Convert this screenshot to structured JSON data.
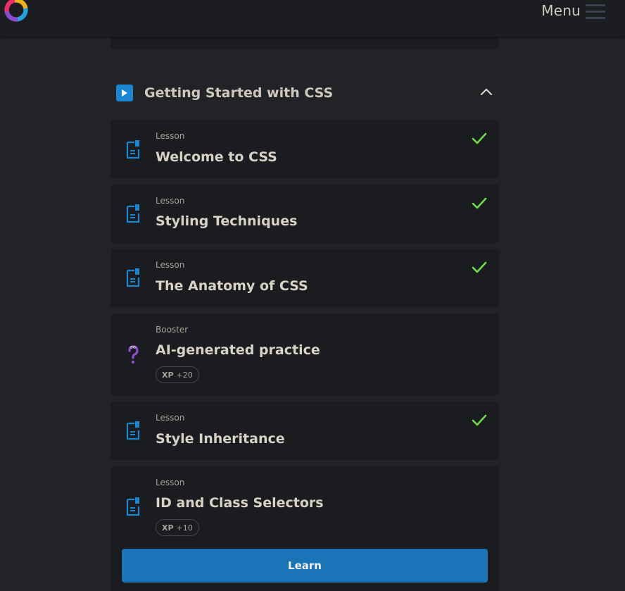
{
  "header": {
    "logo_icon": "swirl-logo-icon",
    "menu_label": "Menu",
    "menu_icon": "hamburger-icon"
  },
  "section": {
    "title": "Getting Started with CSS",
    "icon": "play-icon",
    "expanded": true,
    "accent_color": "#1a86d0"
  },
  "items": [
    {
      "kind": "Lesson",
      "title": "Welcome to CSS",
      "icon": "document-icon",
      "completed": true
    },
    {
      "kind": "Lesson",
      "title": "Styling Techniques",
      "icon": "document-icon",
      "completed": true
    },
    {
      "kind": "Lesson",
      "title": "The Anatomy of CSS",
      "icon": "document-icon",
      "completed": true
    },
    {
      "kind": "Booster",
      "title": "AI-generated practice",
      "icon": "question-mark-icon",
      "completed": false,
      "xp_label": "XP",
      "xp_value": "+20"
    },
    {
      "kind": "Lesson",
      "title": "Style Inheritance",
      "icon": "document-icon",
      "completed": true
    },
    {
      "kind": "Lesson",
      "title": "ID and Class Selectors",
      "icon": "document-icon",
      "completed": false,
      "xp_label": "XP",
      "xp_value": "+10",
      "action_label": "Learn"
    }
  ],
  "colors": {
    "check": "#6fdc4c",
    "lesson_icon": "#1a86d0",
    "booster_icon": "#8a4fd0",
    "learn_button": "#1a74b8"
  }
}
